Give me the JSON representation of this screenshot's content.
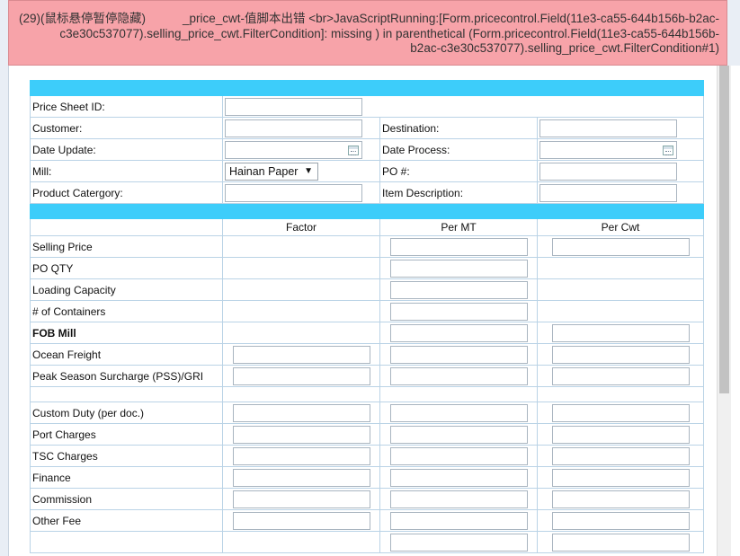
{
  "error": {
    "prefix": "(29)(鼠标悬停暂停隐藏)",
    "message": "_price_cwt-值脚本出错 <br>JavaScriptRunning:[Form.pricecontrol.Field(11e3-ca55-644b156b-b2ac-c3e30c537077).selling_price_cwt.FilterCondition]: missing ) in parenthetical (Form.pricecontrol.Field(11e3-ca55-644b156b-b2ac-c3e30c537077).selling_price_cwt.FilterCondition#1)"
  },
  "header_form": {
    "price_sheet_id": "Price Sheet ID:",
    "customer": "Customer:",
    "destination": "Destination:",
    "date_update": "Date Update:",
    "date_process": "Date Process:",
    "mill": "Mill:",
    "mill_value": "Hainan Paper",
    "po_number": "PO #:",
    "product_category": "Product Catergory:",
    "item_description": "Item Description:"
  },
  "columns": {
    "factor": "Factor",
    "per_mt": "Per MT",
    "per_cwt": "Per Cwt"
  },
  "rows": [
    {
      "label": "Selling Price",
      "factor": false,
      "mt": true,
      "cwt": true
    },
    {
      "label": "PO QTY",
      "factor": false,
      "mt": true,
      "cwt": false
    },
    {
      "label": "Loading Capacity",
      "factor": false,
      "mt": true,
      "cwt": false
    },
    {
      "label": "# of Containers",
      "factor": false,
      "mt": true,
      "cwt": false
    },
    {
      "label": "FOB Mill",
      "factor": false,
      "mt": true,
      "cwt": true,
      "bold": true
    },
    {
      "label": "Ocean Freight",
      "factor": true,
      "mt": true,
      "cwt": true
    },
    {
      "label": "Peak Season Surcharge (PSS)/GRI",
      "factor": true,
      "mt": true,
      "cwt": true
    },
    {
      "spacer": true
    },
    {
      "label": "Custom Duty (per doc.)",
      "factor": true,
      "mt": true,
      "cwt": true
    },
    {
      "label": "Port Charges",
      "factor": true,
      "mt": true,
      "cwt": true
    },
    {
      "label": "TSC Charges",
      "factor": true,
      "mt": true,
      "cwt": true
    },
    {
      "label": "Finance",
      "factor": true,
      "mt": true,
      "cwt": true
    },
    {
      "label": "Commission",
      "factor": true,
      "mt": true,
      "cwt": true
    },
    {
      "label": "Other Fee",
      "factor": true,
      "mt": true,
      "cwt": true
    },
    {
      "label": "",
      "factor": false,
      "mt": true,
      "cwt": true
    }
  ]
}
